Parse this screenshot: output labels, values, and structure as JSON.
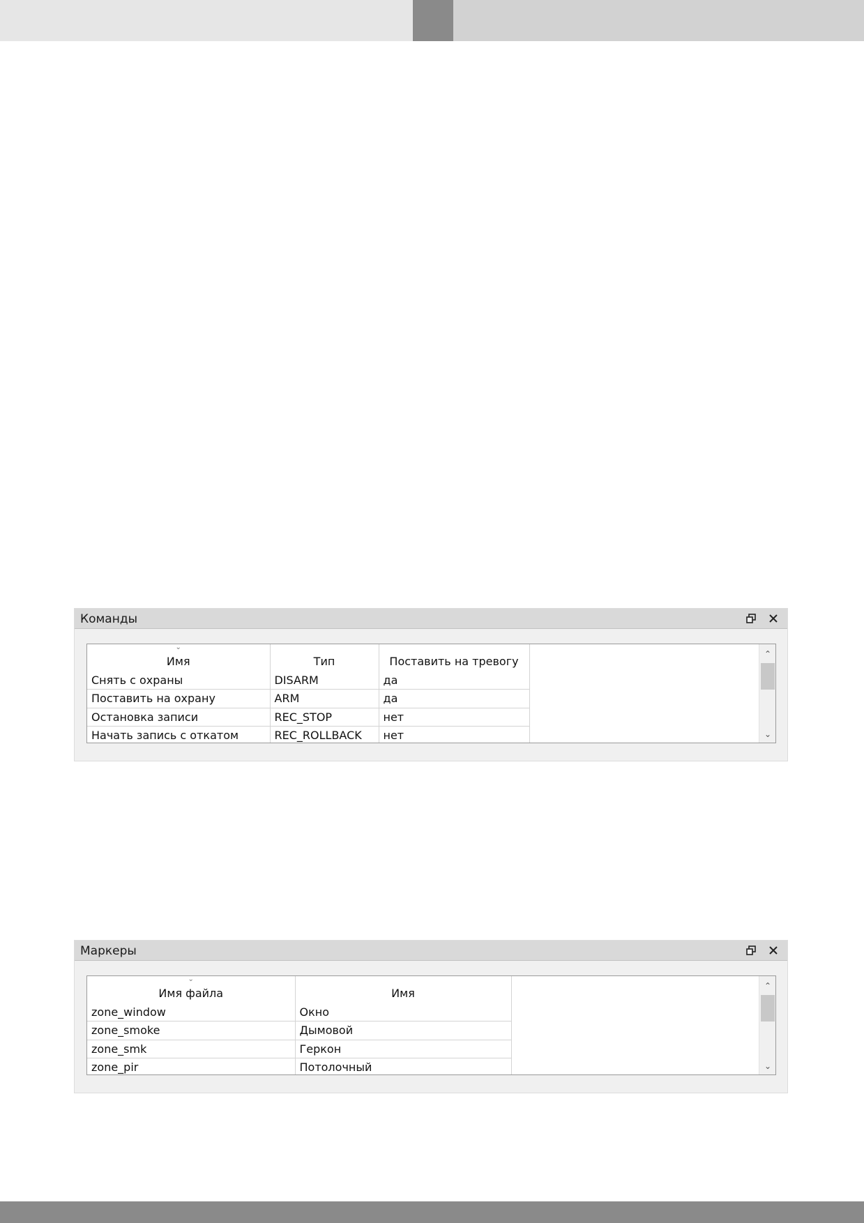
{
  "commands_panel": {
    "title": "Команды",
    "columns": [
      "Имя",
      "Тип",
      "Поставить на тревогу"
    ],
    "rows": [
      [
        "Снять с охраны",
        "DISARM",
        "да"
      ],
      [
        "Поставить на охрану",
        "ARM",
        "да"
      ],
      [
        "Остановка записи",
        "REC_STOP",
        "нет"
      ],
      [
        "Начать запись с откатом",
        "REC_ROLLBACK",
        "нет"
      ]
    ]
  },
  "markers_panel": {
    "title": "Маркеры",
    "columns": [
      "Имя файла",
      "Имя"
    ],
    "rows": [
      [
        "zone_window",
        "Окно"
      ],
      [
        "zone_smoke",
        "Дымовой"
      ],
      [
        "zone_smk",
        "Геркон"
      ],
      [
        "zone_pir",
        "Потолочный"
      ]
    ]
  },
  "icons": {
    "restore": "restore-window-icon",
    "close": "close-icon",
    "sort": "sort-indicator-icon",
    "scroll_up": "chevron-up-icon",
    "scroll_down": "chevron-down-icon"
  },
  "colors": {
    "header_light": "#e6e6e6",
    "header_accent": "#8a8a8a",
    "header_mid": "#d2d2d2",
    "panel_title_bg": "#d9d9d9",
    "panel_bg": "#f0f0f0"
  }
}
